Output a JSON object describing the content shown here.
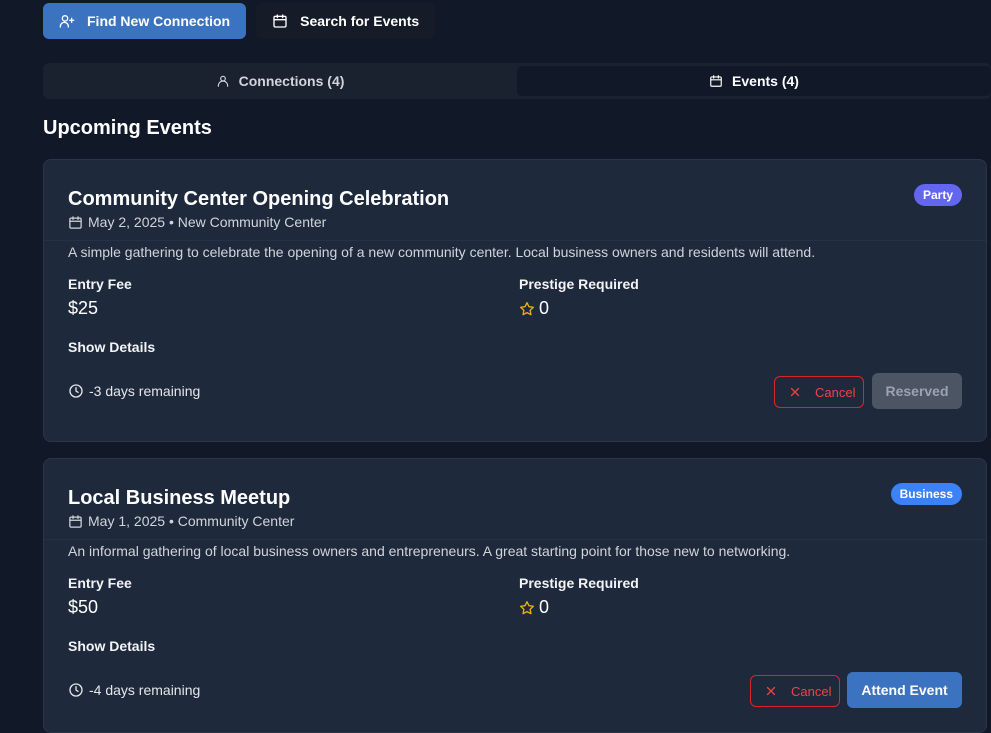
{
  "toolbar": {
    "find_connection_label": "Find New Connection",
    "search_events_label": "Search for Events"
  },
  "tabs": [
    {
      "label": "Connections (4)",
      "icon": "user-icon",
      "active": false
    },
    {
      "label": "Events (4)",
      "icon": "calendar-icon",
      "active": true
    }
  ],
  "section_title": "Upcoming Events",
  "field_labels": {
    "entry_fee": "Entry Fee",
    "prestige": "Prestige Required",
    "show_details": "Show Details",
    "cancel": "Cancel"
  },
  "events": [
    {
      "title": "Community Center Opening Celebration",
      "date_location": "May 2, 2025 • New Community Center",
      "badge": "Party",
      "badge_color": "#6366f1",
      "description": "A simple gathering to celebrate the opening of a new community center. Local business owners and residents will attend.",
      "entry_fee": "$25",
      "prestige": "0",
      "remaining": "-3 days remaining",
      "action_label": "Reserved",
      "action_state": "reserved"
    },
    {
      "title": "Local Business Meetup",
      "date_location": "May 1, 2025 • Community Center",
      "badge": "Business",
      "badge_color": "#3b82f6",
      "description": "An informal gathering of local business owners and entrepreneurs. A great starting point for those new to networking.",
      "entry_fee": "$50",
      "prestige": "0",
      "remaining": "-4 days remaining",
      "action_label": "Attend Event",
      "action_state": "available"
    }
  ],
  "colors": {
    "background": "#111827",
    "card": "#1e293b",
    "primary": "#3b73c0",
    "danger": "#ef4444",
    "star": "#eab308"
  }
}
